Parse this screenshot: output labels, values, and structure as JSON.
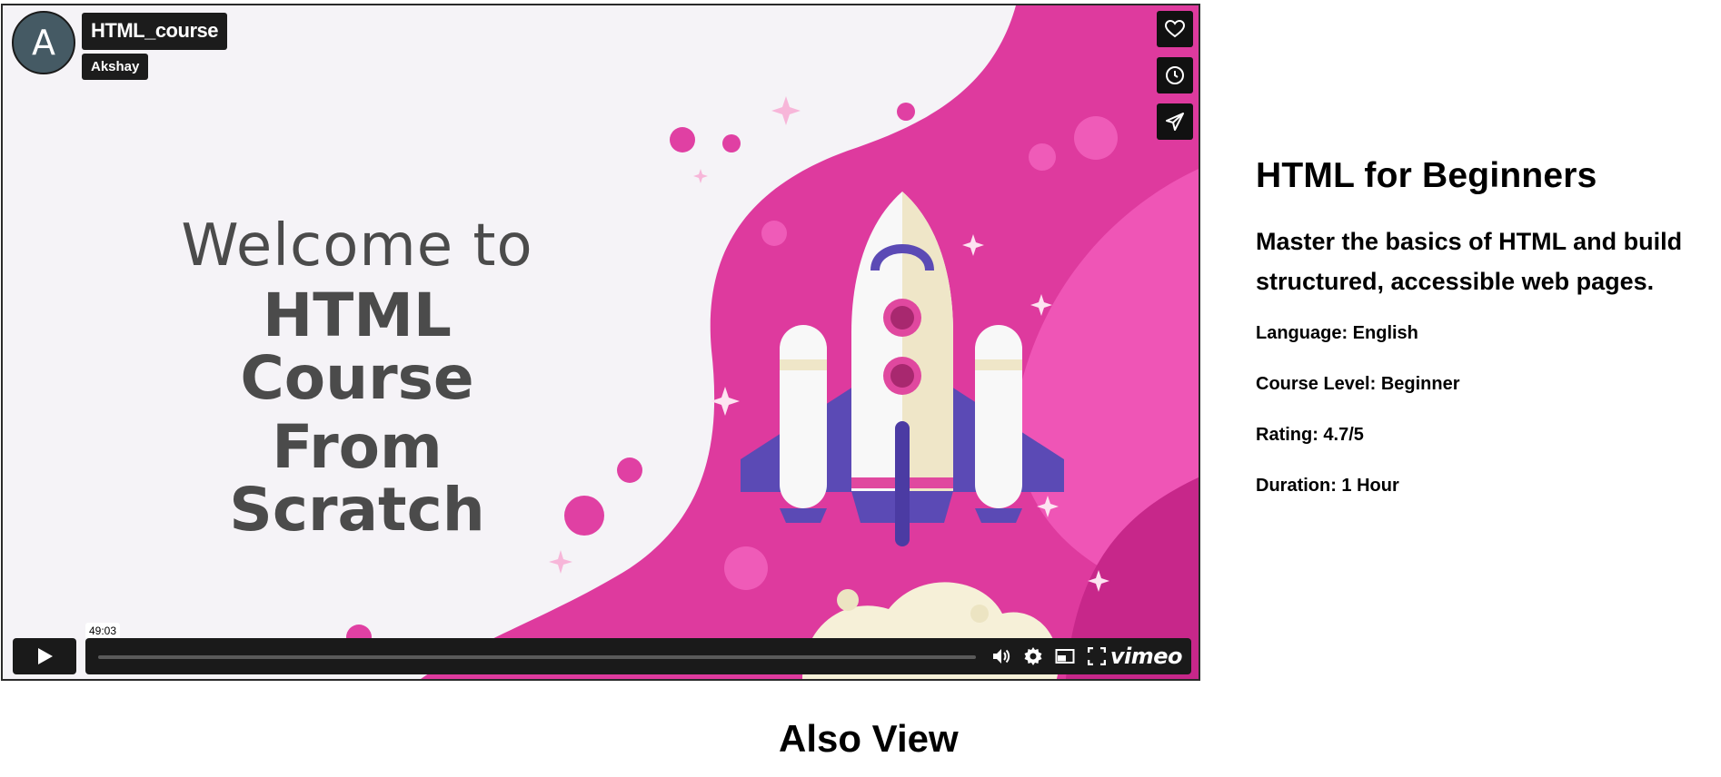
{
  "player": {
    "avatar_letter": "A",
    "video_title": "HTML_course",
    "author": "Akshay",
    "thumbnail_lines": [
      "Welcome to",
      "HTML Course",
      "From Scratch"
    ],
    "time_tooltip": "49:03",
    "progress": 0.0,
    "brand": "vimeo",
    "side_buttons": [
      "heart-icon",
      "clock-icon",
      "share-icon"
    ],
    "control_icons": [
      "volume-icon",
      "gear-icon",
      "pip-icon",
      "fullscreen-icon"
    ]
  },
  "info": {
    "title": "HTML for Beginners",
    "description": "Master the basics of HTML and build structured, accessible web pages.",
    "language": "Language: English",
    "level": "Course Level: Beginner",
    "rating": "Rating: 4.7/5",
    "duration": "Duration: 1 Hour"
  },
  "also_view": "Also View",
  "colors": {
    "magenta": "#de3a9e",
    "dark_magenta": "#c92a8c",
    "rocket_purple": "#5b4ab5",
    "control_bg": "#1a1a1a"
  }
}
